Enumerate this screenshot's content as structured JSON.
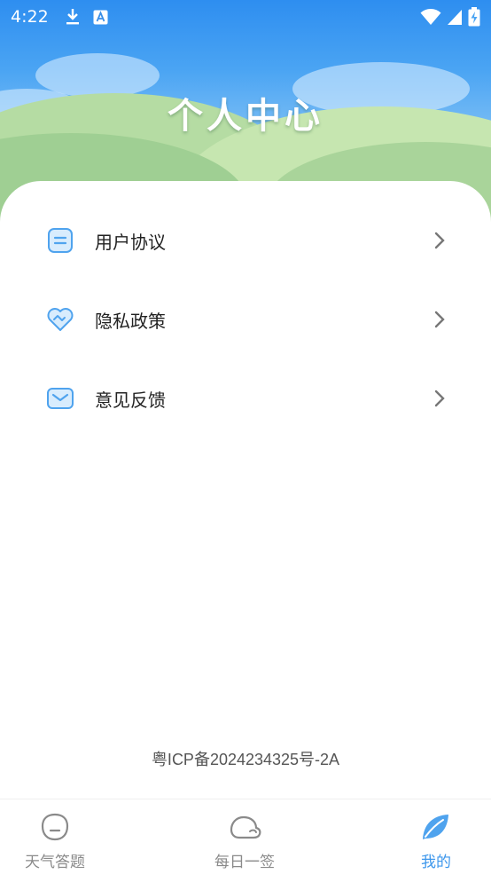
{
  "status_bar": {
    "time": "4:22",
    "left_icons": [
      "download-icon",
      "a-badge-icon"
    ],
    "right_icons": [
      "wifi-icon",
      "signal-icon",
      "battery-charging-icon"
    ]
  },
  "header": {
    "title": "个人中心"
  },
  "menu": {
    "items": [
      {
        "label": "用户协议",
        "icon": "document-icon"
      },
      {
        "label": "隐私政策",
        "icon": "heart-handshake-icon"
      },
      {
        "label": "意见反馈",
        "icon": "mail-icon"
      }
    ]
  },
  "footer": {
    "icp": "粤ICP备2024234325号-2A"
  },
  "tabbar": {
    "tabs": [
      {
        "label": "天气答题",
        "icon": "smiley-bubble-icon",
        "active": false
      },
      {
        "label": "每日一签",
        "icon": "cloud-icon",
        "active": false
      },
      {
        "label": "我的",
        "icon": "leaf-icon",
        "active": true
      }
    ]
  },
  "colors": {
    "accent": "#3d97ec",
    "icon_blue": "#4fa3ee",
    "text": "#222222",
    "muted": "#8a8a8a"
  }
}
